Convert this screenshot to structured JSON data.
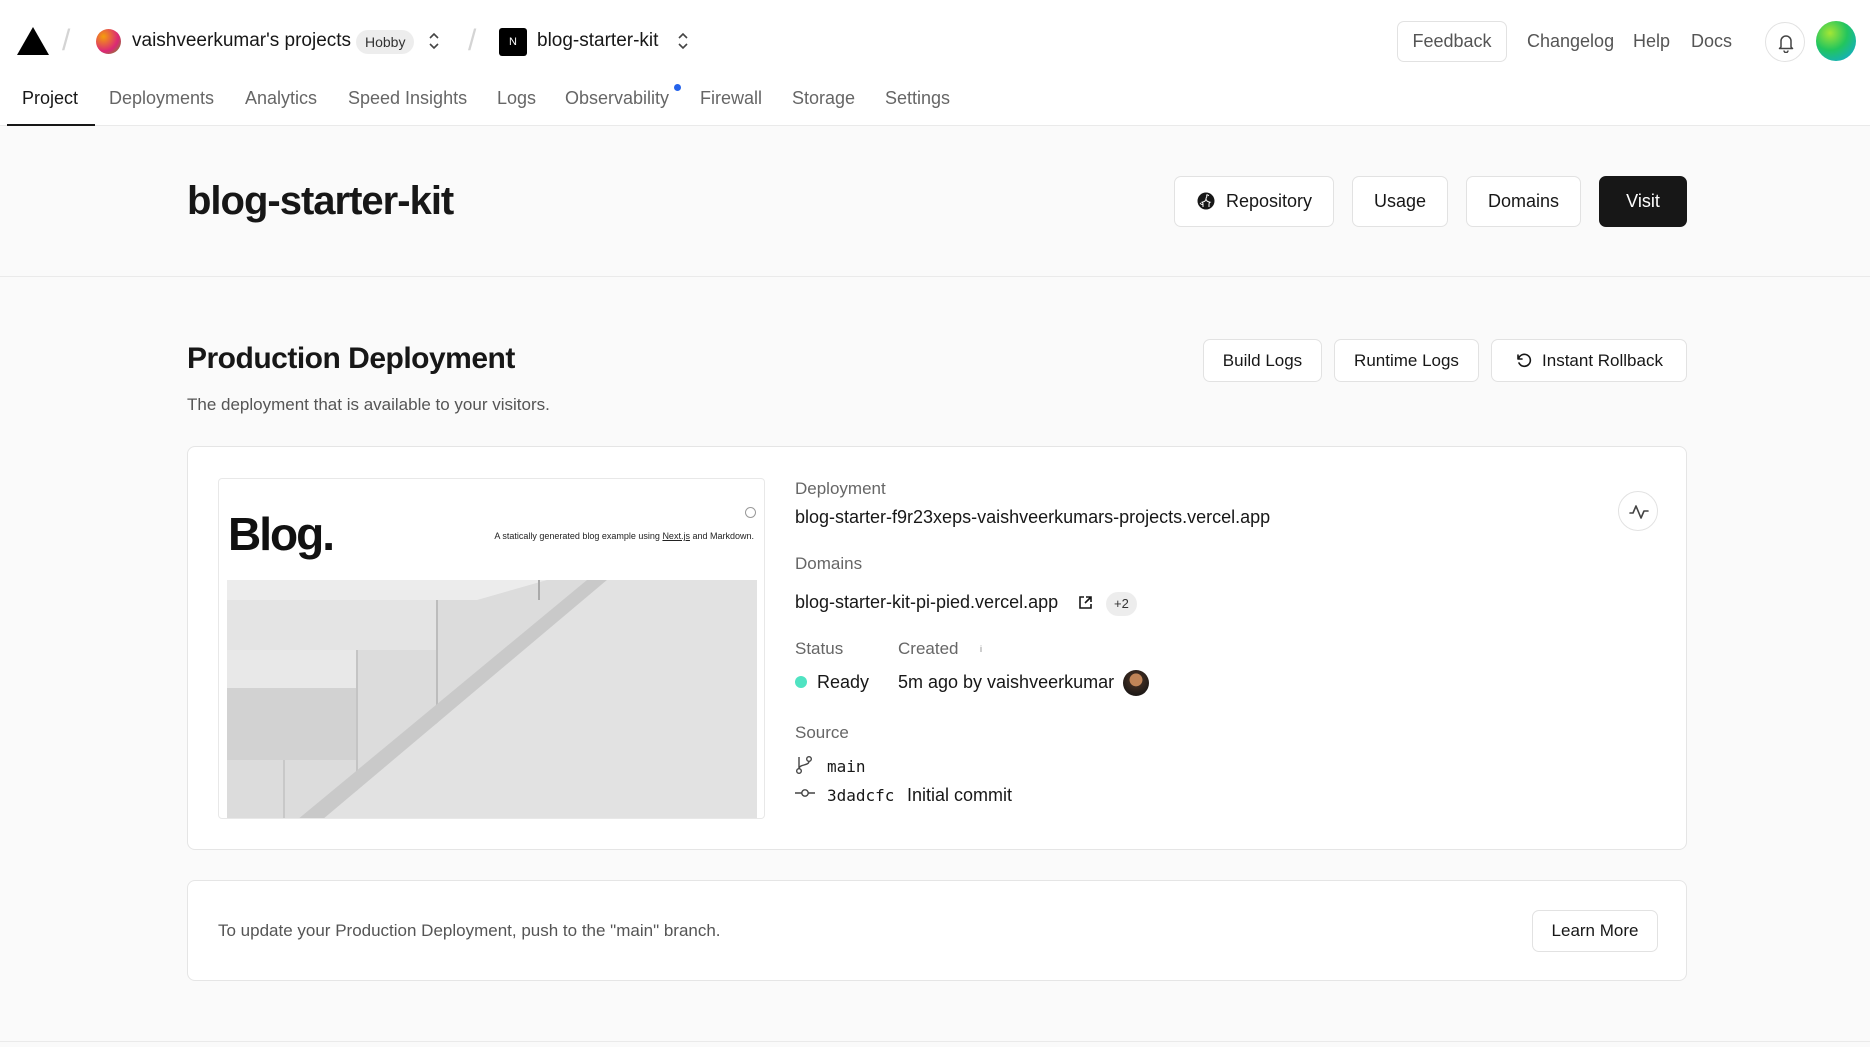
{
  "header": {
    "team_name": "vaishveerkumar's projects",
    "plan": "Hobby",
    "project_icon": "N",
    "project_name": "blog-starter-kit",
    "feedback": "Feedback",
    "links": [
      "Changelog",
      "Help",
      "Docs"
    ]
  },
  "tabs": [
    "Project",
    "Deployments",
    "Analytics",
    "Speed Insights",
    "Logs",
    "Observability",
    "Firewall",
    "Storage",
    "Settings"
  ],
  "active_tab": "Project",
  "page": {
    "title": "blog-starter-kit",
    "buttons": {
      "repository": "Repository",
      "usage": "Usage",
      "domains": "Domains",
      "visit": "Visit"
    }
  },
  "production": {
    "title": "Production Deployment",
    "subtitle": "The deployment that is available to your visitors.",
    "buttons": {
      "build_logs": "Build Logs",
      "runtime_logs": "Runtime Logs",
      "rollback": "Instant Rollback"
    },
    "preview": {
      "heading": "Blog.",
      "tagline_prefix": "A statically generated blog example using ",
      "tagline_link": "Next.js",
      "tagline_suffix": " and Markdown."
    },
    "deployment_label": "Deployment",
    "deployment_url": "blog-starter-f9r23xeps-vaishveerkumars-projects.vercel.app",
    "domains_label": "Domains",
    "domain": "blog-starter-kit-pi-pied.vercel.app",
    "domain_extra": "+2",
    "status_label": "Status",
    "status": "Ready",
    "status_color": "#50e3c2",
    "created_label": "Created",
    "created": "5m ago by vaishveerkumar",
    "source_label": "Source",
    "branch": "main",
    "commit_hash": "3dadcfc",
    "commit_message": "Initial commit"
  },
  "note": {
    "text": "To update your Production Deployment, push to the \"main\" branch.",
    "button": "Learn More"
  }
}
